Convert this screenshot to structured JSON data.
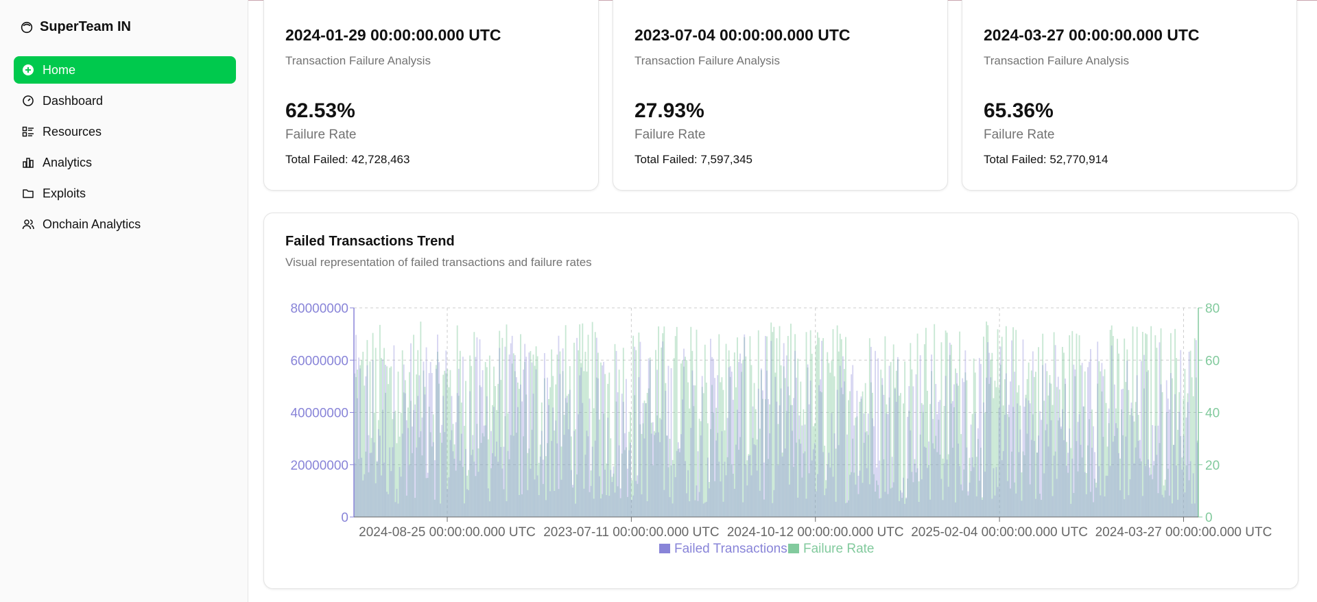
{
  "sidebar": {
    "brand": "SuperTeam IN",
    "items": [
      {
        "label": "Home",
        "icon": "plus-circle-icon",
        "active": true
      },
      {
        "label": "Dashboard",
        "icon": "gauge-icon"
      },
      {
        "label": "Resources",
        "icon": "list-icon"
      },
      {
        "label": "Analytics",
        "icon": "bar-chart-icon"
      },
      {
        "label": "Exploits",
        "icon": "folder-icon"
      },
      {
        "label": "Onchain Analytics",
        "icon": "users-icon"
      }
    ]
  },
  "colors": {
    "accent": "#00c94d",
    "failed_series": "#8884d8",
    "rate_series": "#82ca9d"
  },
  "cards": [
    {
      "date": "2024-01-29 00:00:00.000 UTC",
      "subtitle": "Transaction Failure Analysis",
      "rate": "62.53%",
      "rate_label": "Failure Rate",
      "total": "Total Failed: 42,728,463"
    },
    {
      "date": "2023-07-04 00:00:00.000 UTC",
      "subtitle": "Transaction Failure Analysis",
      "rate": "27.93%",
      "rate_label": "Failure Rate",
      "total": "Total Failed: 7,597,345"
    },
    {
      "date": "2024-03-27 00:00:00.000 UTC",
      "subtitle": "Transaction Failure Analysis",
      "rate": "65.36%",
      "rate_label": "Failure Rate",
      "total": "Total Failed: 52,770,914"
    }
  ],
  "chart_card": {
    "title": "Failed Transactions Trend",
    "description": "Visual representation of failed transactions and failure rates"
  },
  "chart_data": {
    "type": "bar",
    "x_tick_labels": [
      "2024-08-25 00:00:00.000 UTC",
      "2023-07-11 00:00:00.000 UTC",
      "2024-10-12 00:00:00.000 UTC",
      "2025-02-04 00:00:00.000 UTC",
      "2024-03-27 00:00:00.000 UTC"
    ],
    "left_axis": {
      "ticks": [
        "0",
        "20000000",
        "40000000",
        "60000000",
        "80000000"
      ],
      "range": [
        0,
        80000000
      ]
    },
    "right_axis": {
      "ticks": [
        "0",
        "20",
        "40",
        "60",
        "80"
      ],
      "range": [
        0,
        80
      ]
    },
    "grid": true,
    "legend_position": "bottom",
    "series": [
      {
        "name": "Failed Transactions",
        "axis": "left",
        "color": "#8884d8",
        "approx_range": [
          5000000,
          70000000
        ]
      },
      {
        "name": "Failure Rate",
        "axis": "right",
        "color": "#82ca9d",
        "approx_range": [
          5,
          75
        ]
      }
    ],
    "bar_count_estimate": 600
  }
}
